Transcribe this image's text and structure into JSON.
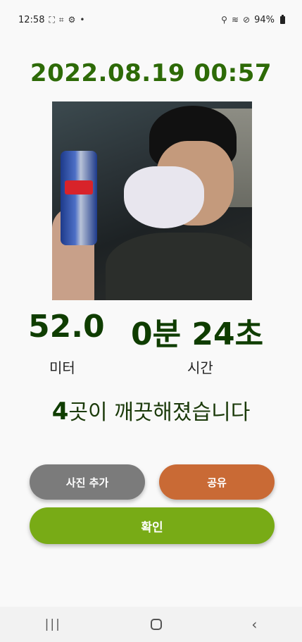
{
  "status_bar": {
    "time": "12:58",
    "left_icons": [
      "screenshot-icon",
      "scan-icon",
      "gear-icon",
      "dot-icon"
    ],
    "battery": "94%",
    "right_icons": [
      "location-icon",
      "wifi-icon",
      "do-not-disturb-icon",
      "battery-icon"
    ]
  },
  "record": {
    "datetime": "2022.08.19 00:57",
    "distance_value": "52.0",
    "distance_label": "미터",
    "time_value": "0분 24초",
    "time_label": "시간",
    "summary_count": "4",
    "summary_text": "곳이 깨끗해졌습니다"
  },
  "buttons": {
    "add_photo": "사진 추가",
    "share": "공유",
    "confirm": "확인"
  },
  "colors": {
    "datetime": "#2d6a07",
    "add_photo": "#7b7b7b",
    "share": "#c96a35",
    "confirm": "#78ab16"
  },
  "nav_bar": {
    "recent_icon": "recent-apps-icon",
    "home_icon": "home-icon",
    "back_icon": "back-icon"
  }
}
